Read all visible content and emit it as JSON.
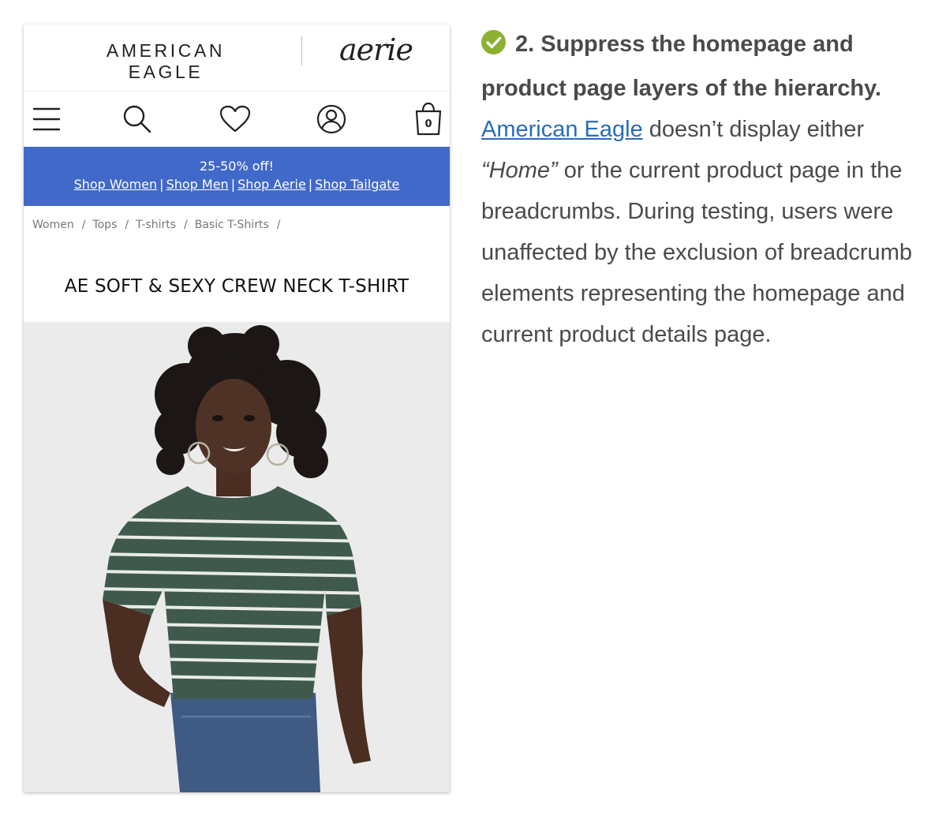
{
  "phone": {
    "brand": {
      "ae": "AMERICAN EAGLE",
      "aerie": "aerie"
    },
    "icons": [
      "menu-icon",
      "search-icon",
      "heart-icon",
      "account-icon",
      "bag-icon"
    ],
    "bag_count": "0",
    "promo": {
      "headline": "25-50% off!",
      "links": [
        "Shop Women",
        "Shop Men",
        "Shop Aerie",
        "Shop Tailgate"
      ],
      "separator": "|",
      "bg_color": "#4169c9"
    },
    "breadcrumbs": [
      "Women",
      "Tops",
      "T-shirts",
      "Basic T-Shirts"
    ],
    "breadcrumb_separator": "/",
    "product_title": "AE SOFT & SEXY CREW NECK T-SHIRT"
  },
  "article": {
    "heading": "2. Suppress the homepage and product page layers of the hierarchy.",
    "link_text": "American Eagle",
    "text_1": " doesn’t display either ",
    "quote": "“Home”",
    "text_2": " or the current product page in the breadcrumbs. During testing, users were unaffected by the exclusion of breadcrumb elements representing the homepage and current product details page.",
    "check_color": "#8ab132",
    "link_color": "#2a6db8"
  }
}
